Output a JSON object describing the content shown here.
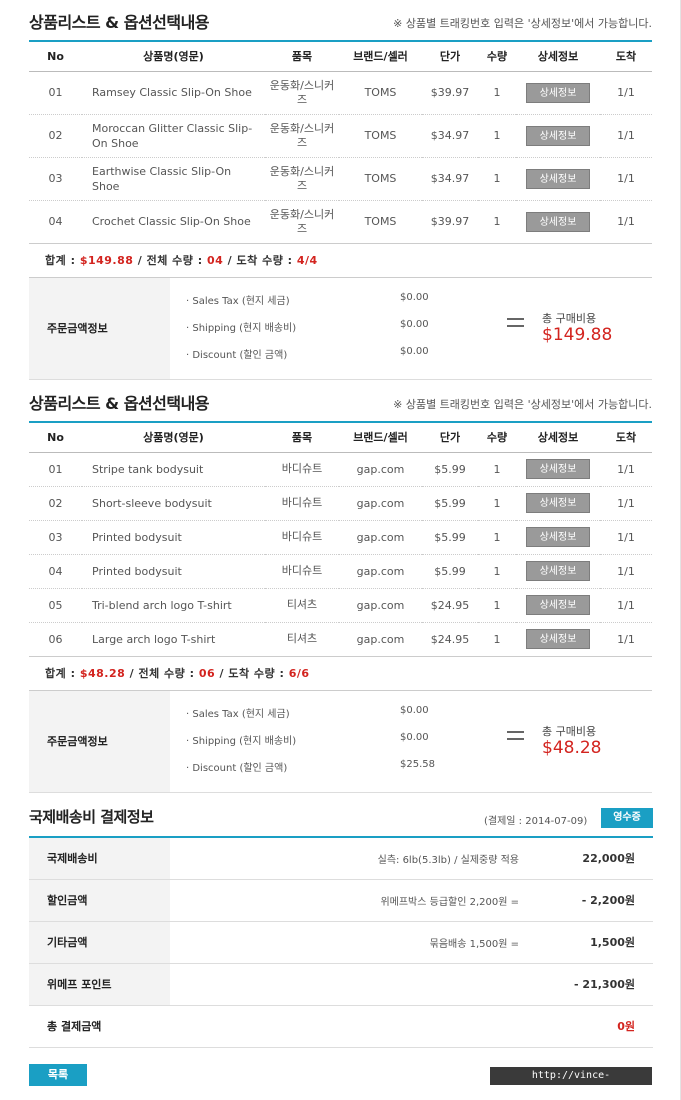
{
  "list_title": "상품리스트 & 옵션선택내용",
  "list_note": "※ 상품별 트래킹번호 입력은 '상세정보'에서 가능합니다.",
  "columns": [
    "No",
    "상품명(영문)",
    "품목",
    "브랜드/셀러",
    "단가",
    "수량",
    "상세정보",
    "도착"
  ],
  "detail_button_label": "상세정보",
  "summary_labels": {
    "total": "합계 :",
    "total_qty": "/ 전체 수량 :",
    "arrived_qty": "/ 도착 수량 :"
  },
  "fee_labels": {
    "tax": "· Sales Tax (현지 세금)",
    "shipping": "· Shipping (현지 배송비)",
    "discount": "· Discount (할인 금액)"
  },
  "order_info_label": "주문금액정보",
  "total_purchase_label": "총 구매비용",
  "orders": [
    {
      "items": [
        {
          "no": "01",
          "name": "Ramsey Classic Slip-On Shoe",
          "category": "운동화/스니커즈",
          "brand": "TOMS",
          "price": "$39.97",
          "qty": "1",
          "arrival": "1/1"
        },
        {
          "no": "02",
          "name": "Moroccan Glitter Classic Slip-On Shoe",
          "category": "운동화/스니커즈",
          "brand": "TOMS",
          "price": "$34.97",
          "qty": "1",
          "arrival": "1/1"
        },
        {
          "no": "03",
          "name": "Earthwise Classic Slip-On Shoe",
          "category": "운동화/스니커즈",
          "brand": "TOMS",
          "price": "$34.97",
          "qty": "1",
          "arrival": "1/1"
        },
        {
          "no": "04",
          "name": "Crochet Classic Slip-On Shoe",
          "category": "운동화/스니커즈",
          "brand": "TOMS",
          "price": "$39.97",
          "qty": "1",
          "arrival": "1/1"
        }
      ],
      "summary": {
        "total": "$149.88",
        "total_qty": "04",
        "arrived_qty": "4/4"
      },
      "fees": {
        "tax": "$0.00",
        "shipping": "$0.00",
        "discount": "$0.00"
      },
      "total_purchase": "$149.88"
    },
    {
      "items": [
        {
          "no": "01",
          "name": "Stripe tank bodysuit",
          "category": "바디슈트",
          "brand": "gap.com",
          "price": "$5.99",
          "qty": "1",
          "arrival": "1/1"
        },
        {
          "no": "02",
          "name": "Short-sleeve bodysuit",
          "category": "바디슈트",
          "brand": "gap.com",
          "price": "$5.99",
          "qty": "1",
          "arrival": "1/1"
        },
        {
          "no": "03",
          "name": "Printed bodysuit",
          "category": "바디슈트",
          "brand": "gap.com",
          "price": "$5.99",
          "qty": "1",
          "arrival": "1/1"
        },
        {
          "no": "04",
          "name": "Printed bodysuit",
          "category": "바디슈트",
          "brand": "gap.com",
          "price": "$5.99",
          "qty": "1",
          "arrival": "1/1"
        },
        {
          "no": "05",
          "name": "Tri-blend arch logo T-shirt",
          "category": "티셔츠",
          "brand": "gap.com",
          "price": "$24.95",
          "qty": "1",
          "arrival": "1/1"
        },
        {
          "no": "06",
          "name": "Large arch logo T-shirt",
          "category": "티셔츠",
          "brand": "gap.com",
          "price": "$24.95",
          "qty": "1",
          "arrival": "1/1"
        }
      ],
      "summary": {
        "total": "$48.28",
        "total_qty": "06",
        "arrived_qty": "6/6"
      },
      "fees": {
        "tax": "$0.00",
        "shipping": "$0.00",
        "discount": "$25.58"
      },
      "total_purchase": "$48.28"
    }
  ],
  "payment": {
    "title": "국제배송비 결제정보",
    "date": "(결제일 : 2014-07-09)",
    "receipt_button": "영수증",
    "rows": [
      {
        "label": "국제배송비",
        "desc": "실측: 6lb(5.3lb) / 실제중량 적용",
        "amount": "22,000원"
      },
      {
        "label": "할인금액",
        "desc": "위메프박스 등급할인 2,200원 =",
        "amount": "- 2,200원"
      },
      {
        "label": "기타금액",
        "desc": "묶음배송 1,500원 =",
        "amount": "1,500원"
      },
      {
        "label": "위메프 포인트",
        "desc": "",
        "amount": "- 21,300원"
      }
    ],
    "total_label": "총 결제금액",
    "total_amount": "0원"
  },
  "list_button": "목록",
  "watermark": "http://vince-tools.tistory.com",
  "colors": {
    "accent": "#1a9fc4",
    "price_red": "#d3241f",
    "button_gray": "#9a9a9a"
  }
}
